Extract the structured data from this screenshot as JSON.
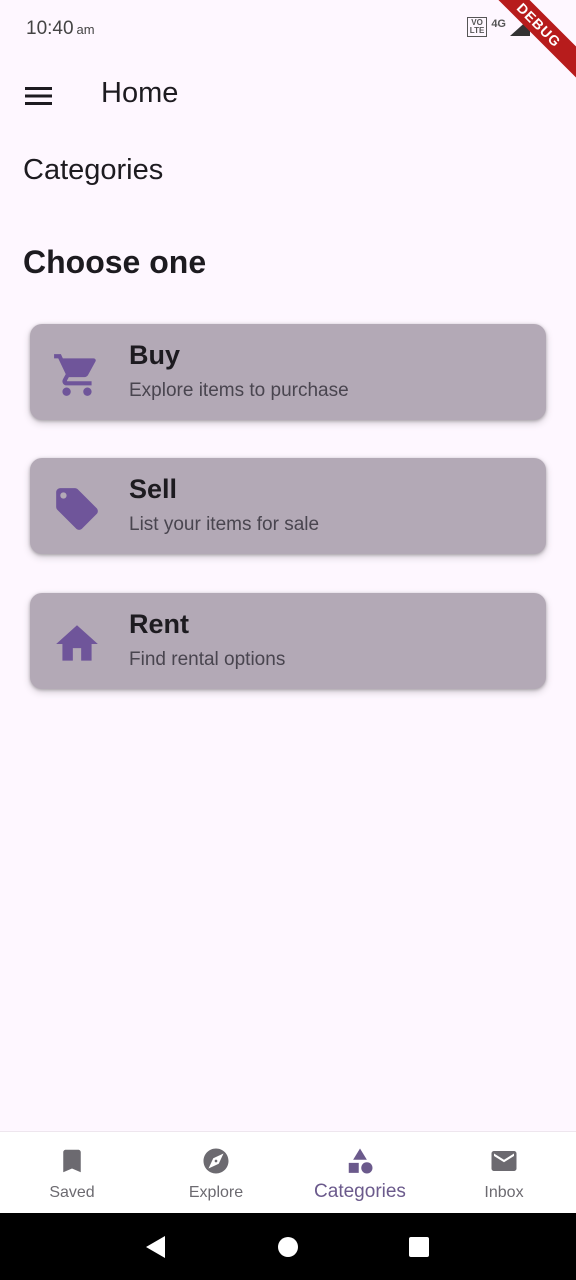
{
  "status_bar": {
    "time": "10:40",
    "ampm": "am",
    "volte_label": "Vo\nLTE",
    "network_label": "4G",
    "debug_label": "DEBUG"
  },
  "app_bar": {
    "title": "Home",
    "menu_icon": "hamburger-menu-icon"
  },
  "main": {
    "section_title": "Categories",
    "subheading": "Choose one",
    "cards": [
      {
        "icon": "cart-icon",
        "title": "Buy",
        "description": "Explore items to purchase"
      },
      {
        "icon": "tag-icon",
        "title": "Sell",
        "description": "List your items for sale"
      },
      {
        "icon": "home-icon",
        "title": "Rent",
        "description": "Find rental options"
      }
    ]
  },
  "bottom_nav": {
    "items": [
      {
        "label": "Saved",
        "icon": "bookmark-icon"
      },
      {
        "label": "Explore",
        "icon": "compass-icon"
      },
      {
        "label": "Categories",
        "icon": "shapes-icon",
        "active": true
      },
      {
        "label": "Inbox",
        "icon": "mail-icon"
      }
    ]
  },
  "colors": {
    "background": "#fef7ff",
    "card": "#b3a9b6",
    "accent": "#6b5a8c",
    "icon_purple": "#6f559a",
    "nav_inactive": "#6c6a70"
  }
}
